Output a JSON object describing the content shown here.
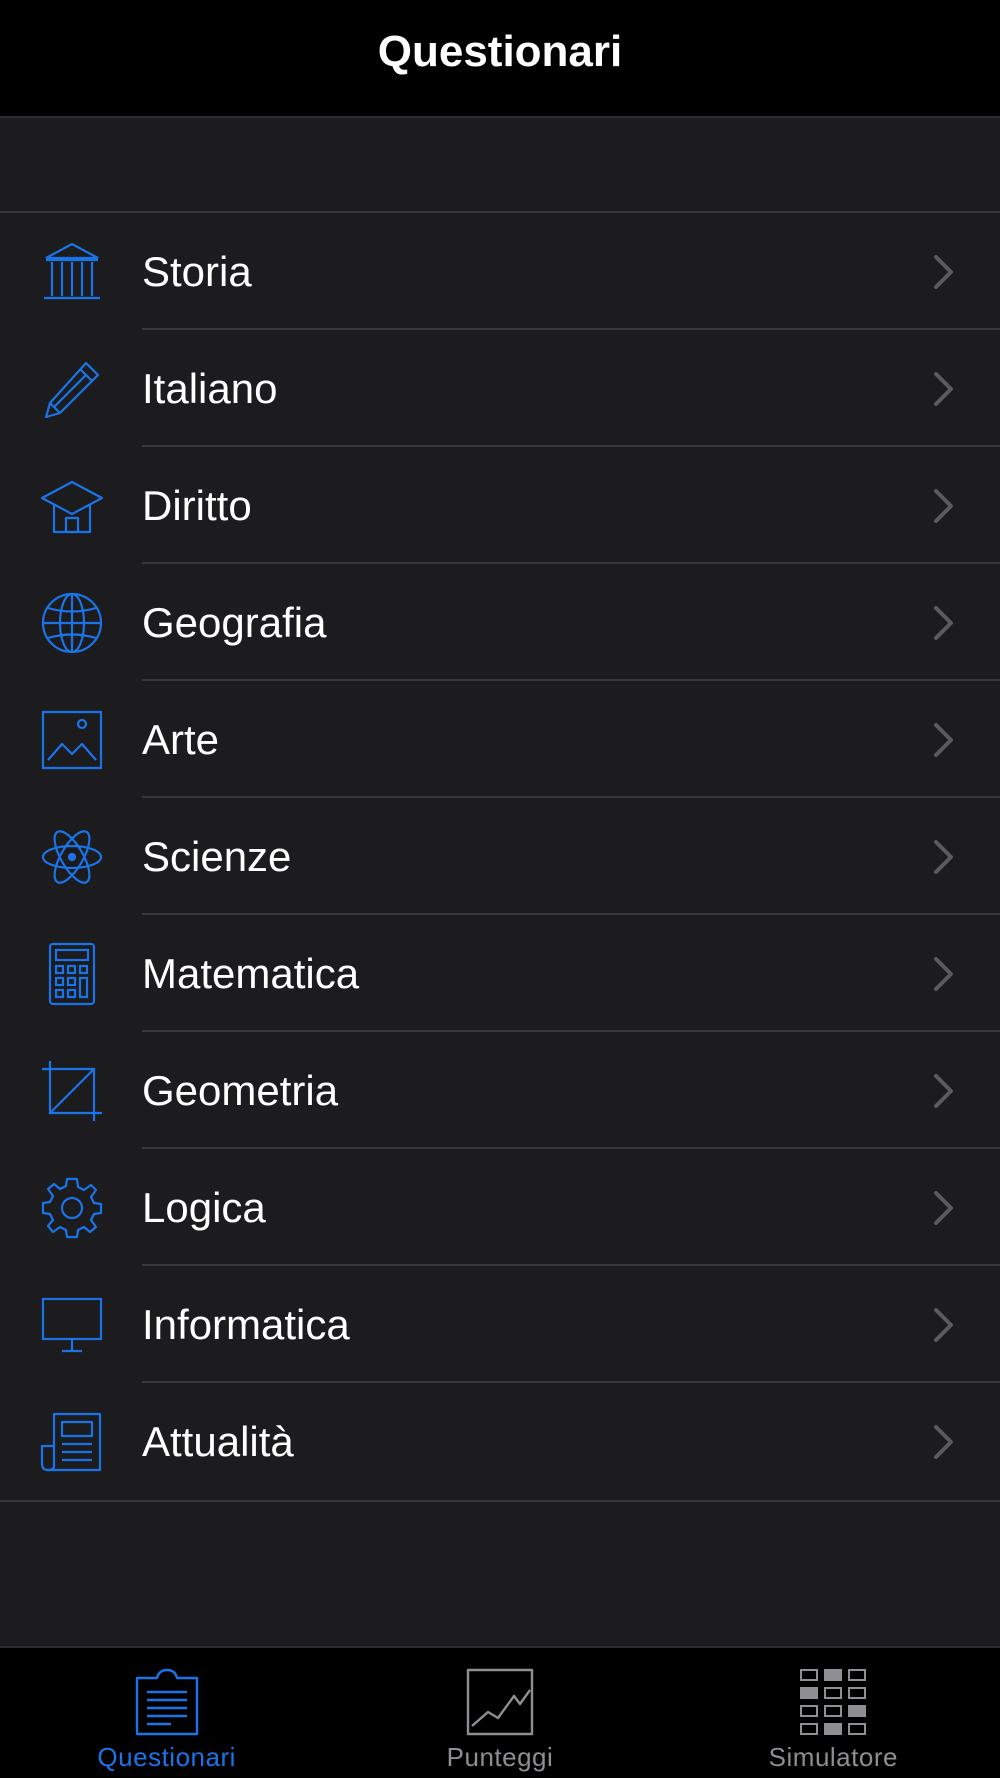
{
  "header": {
    "title": "Questionari"
  },
  "colors": {
    "accent": "#1a74e8",
    "inactive": "#8e8e93",
    "chevron": "#5a5a5f"
  },
  "list": {
    "items": [
      {
        "label": "Storia",
        "icon": "bank-columns-icon"
      },
      {
        "label": "Italiano",
        "icon": "pencil-icon"
      },
      {
        "label": "Diritto",
        "icon": "graduation-cap-icon"
      },
      {
        "label": "Geografia",
        "icon": "globe-icon"
      },
      {
        "label": "Arte",
        "icon": "picture-icon"
      },
      {
        "label": "Scienze",
        "icon": "atom-icon"
      },
      {
        "label": "Matematica",
        "icon": "calculator-icon"
      },
      {
        "label": "Geometria",
        "icon": "crop-square-icon"
      },
      {
        "label": "Logica",
        "icon": "gear-icon"
      },
      {
        "label": "Informatica",
        "icon": "monitor-icon"
      },
      {
        "label": "Attualità",
        "icon": "newspaper-icon"
      }
    ]
  },
  "tabbar": {
    "tabs": [
      {
        "label": "Questionari",
        "icon": "clipboard-icon",
        "selected": true
      },
      {
        "label": "Punteggi",
        "icon": "line-chart-icon",
        "selected": false
      },
      {
        "label": "Simulatore",
        "icon": "grid-blocks-icon",
        "selected": false
      }
    ]
  }
}
